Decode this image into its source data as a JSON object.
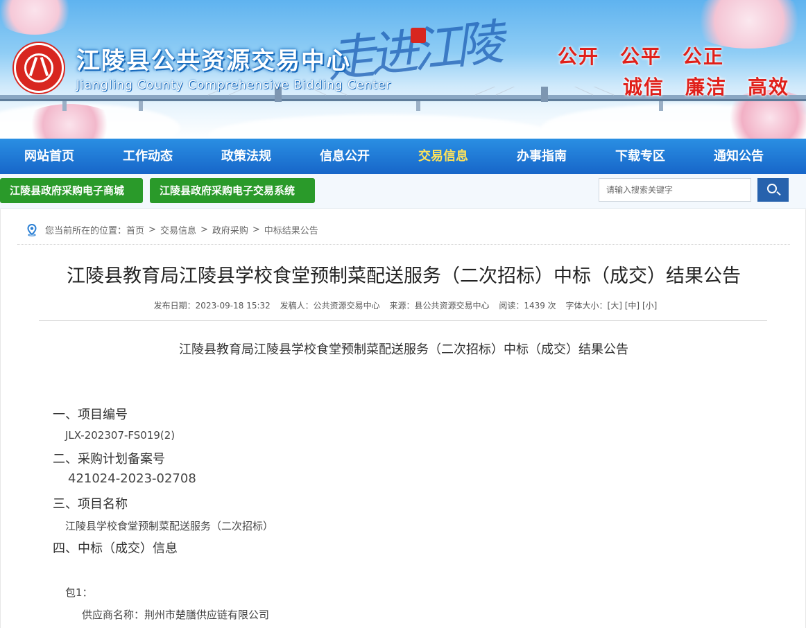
{
  "header": {
    "site_title": "江陵县公共资源交易中心",
    "site_subtitle": "Jiangling County Comprehensive Bidding Center",
    "calligraphy": "走进江陵",
    "motto_row1": [
      "公开",
      "公平",
      "公正"
    ],
    "motto_row2": [
      "诚信",
      "廉洁",
      "高效"
    ],
    "logo_icon": "county-seal-logo"
  },
  "nav": {
    "items": [
      "网站首页",
      "工作动态",
      "政策法规",
      "信息公开",
      "交易信息",
      "办事指南",
      "下载专区",
      "通知公告"
    ],
    "active_index": 4,
    "active_color": "#ffe35a"
  },
  "quickbar": {
    "btn1": "江陵县政府采购电子商城",
    "btn2": "江陵县政府采购电子交易系统",
    "search_placeholder": "请输入搜索关键字",
    "search_icon": "search-icon"
  },
  "breadcrumb": {
    "prefix": "您当前所在的位置：",
    "items": [
      "首页",
      "交易信息",
      "政府采购",
      "中标结果公告"
    ],
    "separator": ">"
  },
  "article": {
    "title": "江陵县教育局江陵县学校食堂预制菜配送服务（二次招标）中标（成交）结果公告",
    "meta": {
      "date": "发布日期：2023-09-18 15:32",
      "author": "发稿人：公共资源交易中心",
      "source": "来源：县公共资源交易中心",
      "reads": "阅读：1439 次",
      "font_size_label": "字体大小：",
      "font_large": "[大]",
      "font_medium": "[中]",
      "font_small": "[小]"
    },
    "body_title": "江陵县教育局江陵县学校食堂预制菜配送服务（二次招标）中标（成交）结果公告",
    "sections": {
      "s1_heading": "一、项目编号",
      "s1_value": "JLX-202307-FS019(2)",
      "s2_heading": "二、采购计划备案号",
      "s2_value": "421024-2023-02708",
      "s3_heading": "三、项目名称",
      "s3_value": "江陵县学校食堂预制菜配送服务（二次招标）",
      "s4_heading": "四、中标（成交）信息",
      "package": "包1：",
      "supplier": "供应商名称：荆州市楚膳供应链有限公司"
    }
  },
  "colors": {
    "nav_blue": "#1766c9",
    "quick_green": "#2a9a2a",
    "search_blue": "#2762ad",
    "motto_red": "#e0201a"
  }
}
